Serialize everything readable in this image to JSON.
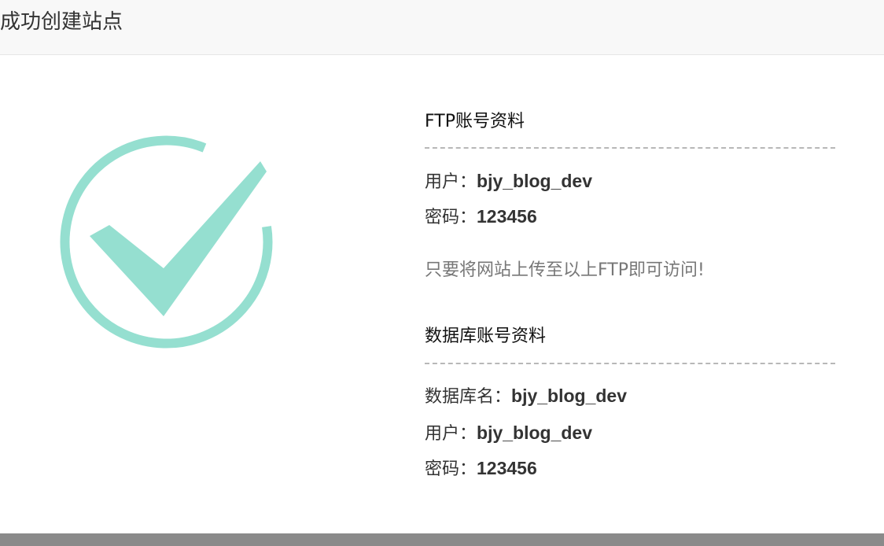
{
  "header": {
    "title": "成功创建站点"
  },
  "ftp": {
    "title": "FTP账号资料",
    "user_label": "用户：",
    "user_value": "bjy_blog_dev",
    "password_label": "密码：",
    "password_value": "123456"
  },
  "note": "只要将网站上传至以上FTP即可访问!",
  "database": {
    "title": "数据库账号资料",
    "name_label": "数据库名：",
    "name_value": "bjy_blog_dev",
    "user_label": "用户：",
    "user_value": "bjy_blog_dev",
    "password_label": "密码：",
    "password_value": "123456"
  },
  "colors": {
    "check": "#95dfd0",
    "header_bg": "#f8f8f8",
    "footer_bar": "#8a8a8a",
    "note_text": "#777777"
  },
  "icons": {
    "success": "check-circle-icon"
  }
}
